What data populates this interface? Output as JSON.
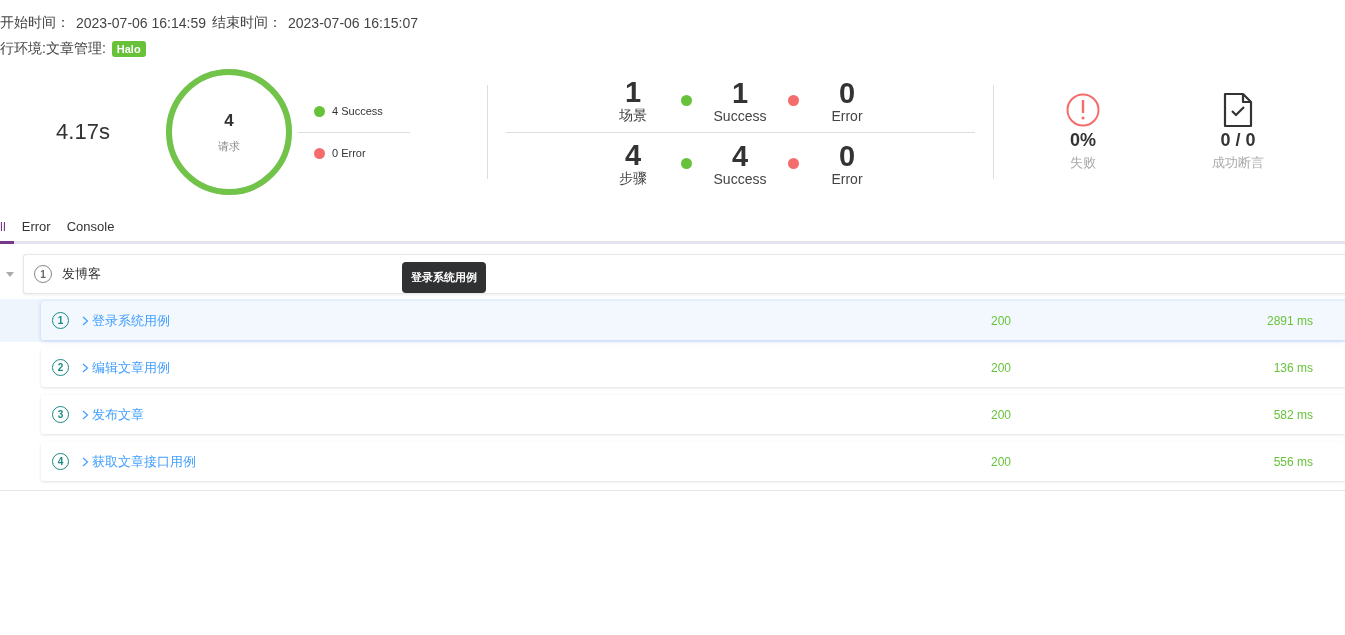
{
  "header": {
    "start_label": "开始时间：",
    "start_time": "2023-07-06 16:14:59",
    "end_label": "结束时间：",
    "end_time": "2023-07-06 16:15:07",
    "env_label": "行环境:文章管理:",
    "env_tag": "Halo"
  },
  "summary": {
    "duration": "4.17s",
    "requests": {
      "count": "4",
      "label": "请求",
      "level": 1
    },
    "legend": [
      {
        "kind": "success",
        "text": "4 Success"
      },
      {
        "kind": "error",
        "text": "0 Error"
      }
    ],
    "counts": [
      {
        "items": [
          {
            "kind": "total",
            "value": "1",
            "label": "场景"
          },
          {
            "kind": "success",
            "value": "1",
            "label": "Success"
          },
          {
            "kind": "error",
            "value": "0",
            "label": "Error"
          }
        ]
      },
      {
        "items": [
          {
            "kind": "total",
            "value": "4",
            "label": "步骤"
          },
          {
            "kind": "success",
            "value": "4",
            "label": "Success"
          },
          {
            "kind": "error",
            "value": "0",
            "label": "Error"
          }
        ]
      }
    ],
    "failure": {
      "value": "0%",
      "label": "失败"
    },
    "assertions": {
      "value": "0 / 0",
      "label": "成功断言"
    }
  },
  "tabs": [
    {
      "label": "ll",
      "selected": true
    },
    {
      "label": "Error",
      "selected": false
    },
    {
      "label": "Console",
      "selected": false
    }
  ],
  "scenario": {
    "index": "1",
    "name": "发博客",
    "expanded": true,
    "steps": [
      {
        "index": "1",
        "name": "登录系统用例",
        "status": "200",
        "time": "2891 ms",
        "selected": true
      },
      {
        "index": "2",
        "name": "编辑文章用例",
        "status": "200",
        "time": "136 ms",
        "selected": false
      },
      {
        "index": "3",
        "name": "发布文章",
        "status": "200",
        "time": "582 ms",
        "selected": false
      },
      {
        "index": "4",
        "name": "获取文章接口用例",
        "status": "200",
        "time": "556 ms",
        "selected": false
      }
    ]
  },
  "tooltip": {
    "text": "登录系统用例"
  }
}
